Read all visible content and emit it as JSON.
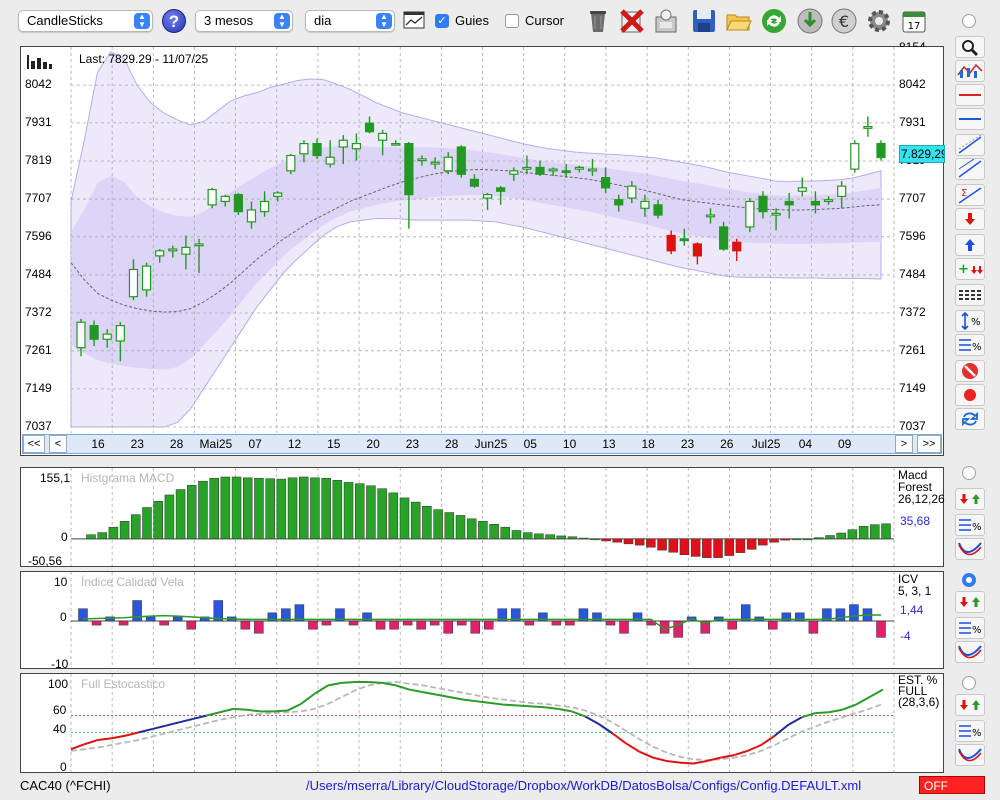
{
  "toolbar": {
    "chart_type": "CandleSticks",
    "period": "3 mesos",
    "interval": "dia",
    "help": "?",
    "guies_label": "Guies",
    "guies_checked": true,
    "cursor_label": "Cursor",
    "cursor_checked": false,
    "icons": [
      "delete-icon",
      "clear-icon",
      "import-icon",
      "save-icon",
      "open-folder-icon",
      "refresh-icon",
      "download-icon",
      "currency-icon",
      "settings-icon",
      "calendar-icon"
    ],
    "calendar_day": "17"
  },
  "main_chart": {
    "last_label": "Last: 7829.29 - 11/07/25",
    "price_badge": "7.829,29",
    "y_labels": [
      "8042",
      "7931",
      "7819",
      "7707",
      "7596",
      "7484",
      "7372",
      "7261",
      "7149",
      "7037"
    ],
    "y_top_partial": "8154",
    "x_labels": [
      "16",
      "23",
      "28",
      "Mai25",
      "07",
      "12",
      "15",
      "20",
      "23",
      "28",
      "Jun25",
      "05",
      "10",
      "13",
      "18",
      "23",
      "26",
      "Jul25",
      "04",
      "09"
    ],
    "nav": {
      "first": "<<",
      "prev": "<",
      "next": ">",
      "last": ">>"
    }
  },
  "chart_data": [
    {
      "type": "candlestick",
      "ylim": [
        7037,
        8154
      ],
      "candles": [
        {
          "o": 7270,
          "h": 7355,
          "l": 7245,
          "c": 7345
        },
        {
          "o": 7335,
          "h": 7350,
          "l": 7275,
          "c": 7295
        },
        {
          "o": 7295,
          "h": 7325,
          "l": 7270,
          "c": 7310
        },
        {
          "o": 7290,
          "h": 7345,
          "l": 7230,
          "c": 7335
        },
        {
          "o": 7420,
          "h": 7530,
          "l": 7410,
          "c": 7500
        },
        {
          "o": 7440,
          "h": 7520,
          "l": 7420,
          "c": 7510
        },
        {
          "o": 7540,
          "h": 7560,
          "l": 7520,
          "c": 7555
        },
        {
          "o": 7555,
          "h": 7570,
          "l": 7535,
          "c": 7560
        },
        {
          "o": 7545,
          "h": 7600,
          "l": 7500,
          "c": 7565
        },
        {
          "o": 7570,
          "h": 7590,
          "l": 7490,
          "c": 7575
        },
        {
          "o": 7690,
          "h": 7740,
          "l": 7680,
          "c": 7735
        },
        {
          "o": 7700,
          "h": 7720,
          "l": 7685,
          "c": 7715
        },
        {
          "o": 7720,
          "h": 7725,
          "l": 7660,
          "c": 7670
        },
        {
          "o": 7640,
          "h": 7700,
          "l": 7620,
          "c": 7675
        },
        {
          "o": 7670,
          "h": 7730,
          "l": 7655,
          "c": 7700
        },
        {
          "o": 7715,
          "h": 7730,
          "l": 7700,
          "c": 7725
        },
        {
          "o": 7790,
          "h": 7840,
          "l": 7780,
          "c": 7835
        },
        {
          "o": 7840,
          "h": 7880,
          "l": 7815,
          "c": 7870
        },
        {
          "o": 7870,
          "h": 7885,
          "l": 7825,
          "c": 7835
        },
        {
          "o": 7810,
          "h": 7880,
          "l": 7800,
          "c": 7830
        },
        {
          "o": 7860,
          "h": 7895,
          "l": 7810,
          "c": 7880
        },
        {
          "o": 7855,
          "h": 7900,
          "l": 7820,
          "c": 7870
        },
        {
          "o": 7930,
          "h": 7950,
          "l": 7900,
          "c": 7905
        },
        {
          "o": 7880,
          "h": 7910,
          "l": 7835,
          "c": 7900
        },
        {
          "o": 7870,
          "h": 7880,
          "l": 7865,
          "c": 7870
        },
        {
          "o": 7870,
          "h": 7875,
          "l": 7620,
          "c": 7720
        },
        {
          "o": 7820,
          "h": 7835,
          "l": 7805,
          "c": 7825
        },
        {
          "o": 7810,
          "h": 7830,
          "l": 7795,
          "c": 7815
        },
        {
          "o": 7790,
          "h": 7845,
          "l": 7780,
          "c": 7830
        },
        {
          "o": 7860,
          "h": 7865,
          "l": 7770,
          "c": 7780
        },
        {
          "o": 7765,
          "h": 7780,
          "l": 7740,
          "c": 7745
        },
        {
          "o": 7710,
          "h": 7725,
          "l": 7675,
          "c": 7720
        },
        {
          "o": 7740,
          "h": 7745,
          "l": 7690,
          "c": 7730
        },
        {
          "o": 7780,
          "h": 7800,
          "l": 7760,
          "c": 7790
        },
        {
          "o": 7795,
          "h": 7835,
          "l": 7780,
          "c": 7800
        },
        {
          "o": 7800,
          "h": 7820,
          "l": 7775,
          "c": 7780
        },
        {
          "o": 7790,
          "h": 7800,
          "l": 7775,
          "c": 7795
        },
        {
          "o": 7790,
          "h": 7810,
          "l": 7770,
          "c": 7785
        },
        {
          "o": 7795,
          "h": 7805,
          "l": 7785,
          "c": 7800
        },
        {
          "o": 7790,
          "h": 7825,
          "l": 7775,
          "c": 7795
        },
        {
          "o": 7770,
          "h": 7800,
          "l": 7725,
          "c": 7740
        },
        {
          "o": 7705,
          "h": 7720,
          "l": 7670,
          "c": 7690
        },
        {
          "o": 7710,
          "h": 7760,
          "l": 7695,
          "c": 7745
        },
        {
          "o": 7680,
          "h": 7720,
          "l": 7655,
          "c": 7700
        },
        {
          "o": 7690,
          "h": 7705,
          "l": 7650,
          "c": 7660
        },
        {
          "o": 7600,
          "h": 7615,
          "l": 7545,
          "c": 7555
        },
        {
          "o": 7590,
          "h": 7620,
          "l": 7570,
          "c": 7585
        },
        {
          "o": 7575,
          "h": 7580,
          "l": 7515,
          "c": 7540
        },
        {
          "o": 7655,
          "h": 7680,
          "l": 7635,
          "c": 7660
        },
        {
          "o": 7625,
          "h": 7640,
          "l": 7555,
          "c": 7560
        },
        {
          "o": 7580,
          "h": 7590,
          "l": 7525,
          "c": 7555
        },
        {
          "o": 7625,
          "h": 7710,
          "l": 7610,
          "c": 7700
        },
        {
          "o": 7715,
          "h": 7730,
          "l": 7650,
          "c": 7670
        },
        {
          "o": 7660,
          "h": 7680,
          "l": 7615,
          "c": 7665
        },
        {
          "o": 7700,
          "h": 7725,
          "l": 7650,
          "c": 7690
        },
        {
          "o": 7730,
          "h": 7770,
          "l": 7715,
          "c": 7740
        },
        {
          "o": 7700,
          "h": 7730,
          "l": 7665,
          "c": 7690
        },
        {
          "o": 7700,
          "h": 7715,
          "l": 7690,
          "c": 7705
        },
        {
          "o": 7715,
          "h": 7760,
          "l": 7680,
          "c": 7745
        },
        {
          "o": 7795,
          "h": 7880,
          "l": 7785,
          "c": 7870
        },
        {
          "o": 7915,
          "h": 7950,
          "l": 7890,
          "c": 7920
        },
        {
          "o": 7870,
          "h": 7880,
          "l": 7820,
          "c": 7829
        }
      ],
      "ma_upper": [
        7700,
        7880,
        8080,
        8140,
        8120,
        8040,
        7990,
        7960,
        7940,
        7925,
        7935,
        7965,
        7995,
        8010,
        8020,
        8035,
        8045,
        8055,
        8060,
        8058,
        8045,
        8030,
        8010,
        7990,
        7975,
        7960,
        7950,
        7940,
        7930,
        7920,
        7910,
        7900,
        7890,
        7880,
        7870,
        7862,
        7855,
        7850,
        7845,
        7842,
        7840,
        7838,
        7835,
        7832,
        7828,
        7822,
        7815,
        7808,
        7800,
        7790,
        7782,
        7775,
        7768,
        7760,
        7758,
        7760,
        7760,
        7762,
        7764,
        7770,
        7780,
        7790
      ],
      "ma_lower": [
        7037,
        7037,
        7037,
        7037,
        7037,
        7037,
        7037,
        7037,
        7050,
        7090,
        7150,
        7210,
        7270,
        7330,
        7390,
        7440,
        7490,
        7530,
        7565,
        7600,
        7625,
        7640,
        7645,
        7650,
        7650,
        7648,
        7645,
        7645,
        7645,
        7645,
        7645,
        7642,
        7640,
        7632,
        7625,
        7615,
        7605,
        7595,
        7585,
        7575,
        7565,
        7555,
        7545,
        7535,
        7525,
        7515,
        7505,
        7498,
        7490,
        7482,
        7478,
        7477,
        7477,
        7476,
        7475,
        7475,
        7475,
        7474,
        7474,
        7474,
        7473,
        7472
      ],
      "ma_mid": [
        7520,
        7470,
        7430,
        7410,
        7395,
        7385,
        7378,
        7375,
        7376,
        7385,
        7405,
        7430,
        7460,
        7495,
        7530,
        7560,
        7590,
        7615,
        7640,
        7660,
        7680,
        7700,
        7715,
        7730,
        7745,
        7758,
        7768,
        7778,
        7785,
        7790,
        7793,
        7794,
        7792,
        7790,
        7786,
        7782,
        7778,
        7774,
        7770,
        7765,
        7758,
        7750,
        7742,
        7735,
        7725,
        7715,
        7705,
        7700,
        7695,
        7690,
        7685,
        7680,
        7678,
        7676,
        7675,
        7675,
        7676,
        7678,
        7680,
        7684,
        7688,
        7690
      ]
    },
    {
      "type": "bar",
      "title": "Histgrama MACD",
      "ylim": [
        -50.56,
        155.1
      ],
      "y_labels": [
        "155,1",
        "0",
        "-50,56"
      ],
      "legend": [
        "Macd",
        "Forest",
        "26,12,26"
      ],
      "current_value": "35,68",
      "values": [
        10,
        15,
        28,
        42,
        58,
        75,
        90,
        105,
        118,
        128,
        138,
        145,
        148,
        148,
        146,
        145,
        144,
        143,
        146,
        148,
        146,
        145,
        140,
        135,
        132,
        127,
        120,
        110,
        98,
        88,
        78,
        70,
        63,
        56,
        48,
        42,
        35,
        28,
        20,
        15,
        12,
        10,
        7,
        5,
        2,
        0,
        -5,
        -8,
        -12,
        -15,
        -20,
        -27,
        -32,
        -38,
        -42,
        -45,
        -45,
        -40,
        -33,
        -25,
        -15,
        -8,
        -3,
        0,
        0,
        3,
        8,
        14,
        22,
        30,
        34,
        36
      ]
    },
    {
      "type": "bar",
      "title": "Índice Calidad Vela",
      "ylim": [
        -10,
        10
      ],
      "y_labels": [
        "10",
        "0",
        "-10"
      ],
      "legend": [
        "ICV",
        "5, 3, 1"
      ],
      "current_values": [
        "1,44",
        "-4"
      ],
      "values": [
        3,
        -1,
        1,
        -1,
        5,
        1,
        -1,
        1,
        -2,
        1,
        5,
        1,
        -2,
        -3,
        2,
        3,
        4,
        -2,
        -1,
        3,
        -1,
        2,
        -2,
        -2,
        -1,
        -2,
        -1,
        -3,
        -1,
        -3,
        -2,
        3,
        3,
        -1,
        2,
        -1,
        -1,
        3,
        2,
        -1,
        -3,
        2,
        -1,
        -3,
        -4,
        1,
        -3,
        1,
        -2,
        4,
        1,
        -2,
        2,
        2,
        -3,
        3,
        3,
        4,
        3,
        -4
      ],
      "line": [
        0.5,
        0.6,
        0.7,
        0.8,
        1,
        1.2,
        1.3,
        1.2,
        1,
        0.8,
        0.6,
        0.5,
        0.4,
        0.4,
        0.4,
        0.4,
        0.4,
        0.4,
        0.4,
        0.4,
        0.4,
        0.4,
        0.4,
        0.4,
        0.4,
        0.4,
        0.4,
        0.4,
        0.4,
        0.4,
        0.4,
        0.4,
        0.4,
        0.4,
        0.4,
        0.4,
        0.4,
        0.4,
        0.4,
        0.4,
        0.4,
        0.4,
        0.4,
        -2,
        -1,
        0.5,
        -0.5,
        0.4,
        0.4,
        0.4,
        0.4,
        0.4,
        0.4,
        0.4,
        0.4,
        0.4,
        0.8,
        1.2,
        1.5,
        1.44
      ]
    },
    {
      "type": "line",
      "title": "Full Estocastico",
      "ylim": [
        0,
        100
      ],
      "y_labels": [
        "100",
        "60",
        "40",
        "0"
      ],
      "legend": [
        "EST. %",
        "FULL",
        "(28,3,6)"
      ],
      "k": [
        20,
        26,
        31,
        33,
        36,
        40,
        44,
        48,
        52,
        56,
        60,
        64,
        68,
        67,
        65,
        65,
        66,
        74,
        86,
        96,
        99,
        100,
        100,
        99,
        96,
        91,
        88,
        85,
        82,
        79,
        77,
        75,
        73,
        72,
        71,
        70,
        68,
        65,
        59,
        50,
        39,
        27,
        17,
        10,
        6,
        4,
        3,
        6,
        10,
        13,
        18,
        25,
        36,
        49,
        58,
        63,
        64,
        67,
        73,
        82,
        91
      ],
      "d": [
        18,
        20,
        22,
        25,
        28,
        31,
        35,
        39,
        43,
        47,
        51,
        55,
        58,
        61,
        62,
        63,
        64,
        65,
        68,
        74,
        82,
        90,
        96,
        99,
        100,
        98,
        96,
        93,
        90,
        87,
        84,
        81,
        79,
        77,
        75,
        74,
        72,
        70,
        66,
        60,
        52,
        42,
        32,
        23,
        16,
        11,
        8,
        7,
        8,
        10,
        13,
        18,
        25,
        33,
        41,
        47,
        53,
        58,
        63,
        68,
        74
      ]
    }
  ],
  "status": {
    "symbol": "CAC40 (^FCHI)",
    "path": "/Users/mserra/Library/CloudStorage/Dropbox/WorkDB/DatosBolsa/Configs/Config.DEFAULT.xml",
    "off": "OFF"
  }
}
